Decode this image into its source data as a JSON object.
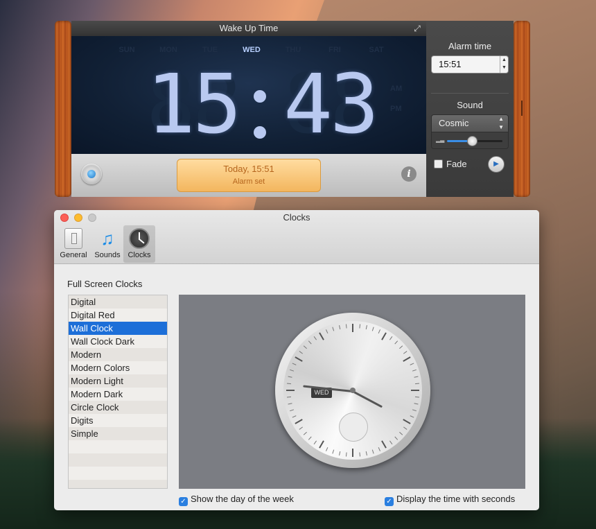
{
  "widget": {
    "title": "Wake Up Time",
    "days": [
      "SUN",
      "MON",
      "TUE",
      "WED",
      "THU",
      "FRI",
      "SAT"
    ],
    "active_day": "WED",
    "am": "AM",
    "pm": "PM",
    "hours": "15",
    "minutes": "43",
    "status_main": "Today, 15:51",
    "status_sub": "Alarm set",
    "info_glyph": "i"
  },
  "alarm_panel": {
    "alarm_time_label": "Alarm time",
    "alarm_time_value": "15:51",
    "sound_label": "Sound",
    "sound_value": "Cosmic",
    "volume_fraction": 0.45,
    "fade_label": "Fade",
    "fade_checked": false
  },
  "prefs": {
    "title": "Clocks",
    "toolbar": [
      {
        "label": "General",
        "icon": "general-icon"
      },
      {
        "label": "Sounds",
        "icon": "music-note-icon"
      },
      {
        "label": "Clocks",
        "icon": "clock-icon",
        "active": true
      }
    ],
    "section_label": "Full Screen Clocks",
    "clocks": [
      "Digital",
      "Digital Red",
      "Wall Clock",
      "Wall Clock Dark",
      "Modern",
      "Modern Colors",
      "Modern Light",
      "Modern Dark",
      "Circle Clock",
      "Digits",
      "Simple"
    ],
    "selected_clock": "Wall Clock",
    "preview_day": "WED",
    "option_day_of_week": "Show the day of the week",
    "option_seconds": "Display the time with seconds",
    "option_day_checked": true,
    "option_seconds_checked": true
  },
  "colors": {
    "accent": "#1d6fd8",
    "lcd_digit": "#b9c9f0",
    "status_bg": "#f3b65e"
  }
}
